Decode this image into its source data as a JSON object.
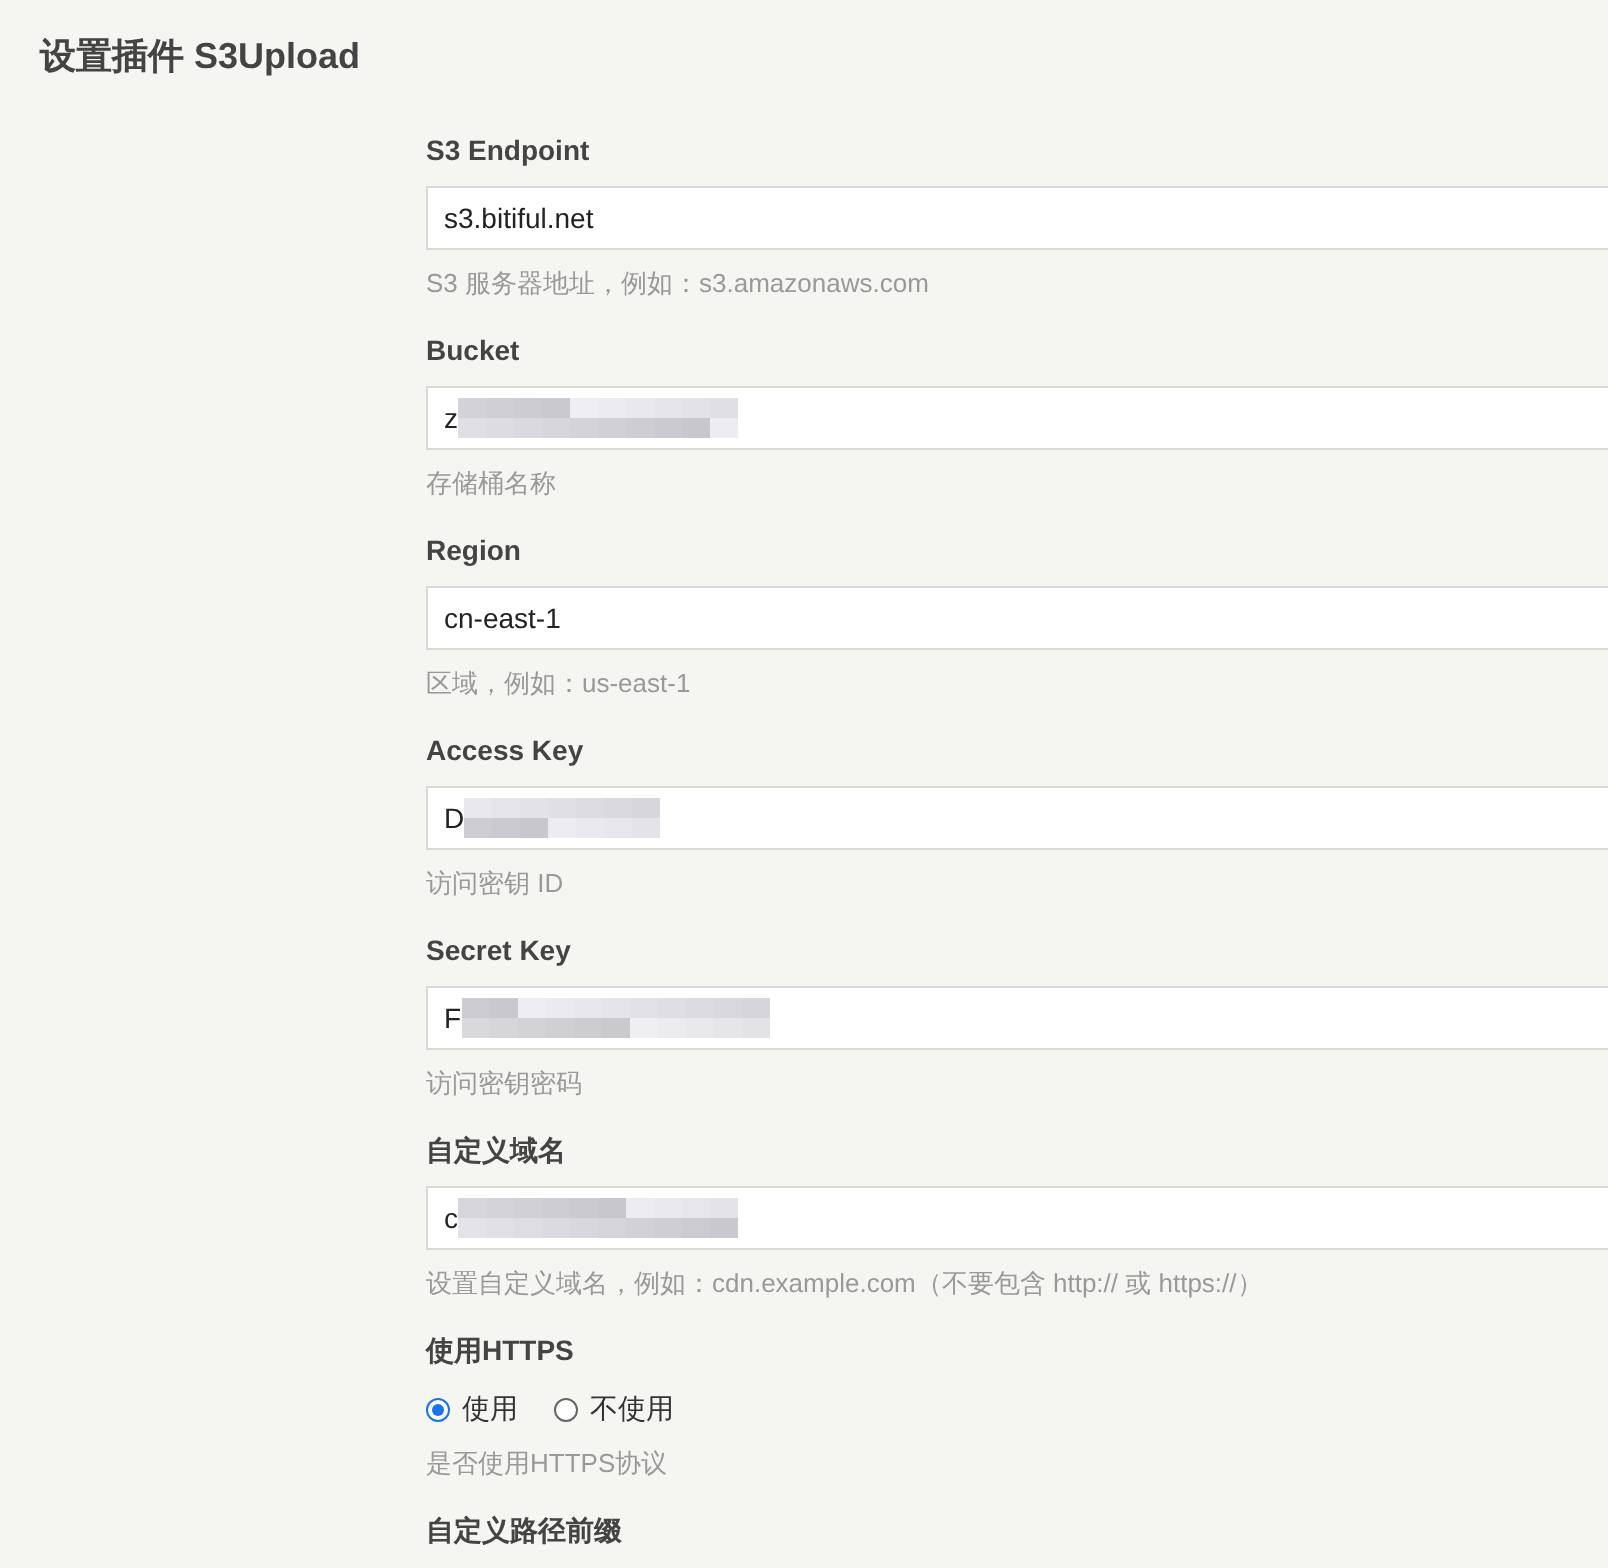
{
  "title": "设置插件 S3Upload",
  "fields": [
    {
      "kind": "text",
      "label": "S3 Endpoint",
      "value": "s3.bitiful.net",
      "redacted": false,
      "hint": "S3 服务器地址，例如：s3.amazonaws.com"
    },
    {
      "kind": "text",
      "label": "Bucket",
      "value": "z",
      "redacted": true,
      "hint": "存储桶名称"
    },
    {
      "kind": "text",
      "label": "Region",
      "value": "cn-east-1",
      "redacted": false,
      "hint": "区域，例如：us-east-1"
    },
    {
      "kind": "text",
      "label": "Access Key",
      "value": "D",
      "redacted": true,
      "hint": "访问密钥 ID"
    },
    {
      "kind": "text",
      "label": "Secret Key",
      "value": "F",
      "redacted": true,
      "hint": "访问密钥密码"
    },
    {
      "kind": "text",
      "label": "自定义域名",
      "value": "c",
      "redacted": true,
      "hint": "设置自定义域名，例如：cdn.example.com（不要包含 http:// 或 https://）"
    },
    {
      "kind": "radio",
      "label": "使用HTTPS",
      "options": [
        {
          "label": "使用",
          "selected": true
        },
        {
          "label": "不使用",
          "selected": false
        }
      ],
      "hint": "是否使用HTTPS协议"
    },
    {
      "kind": "heading",
      "label": "自定义路径前缀"
    }
  ]
}
